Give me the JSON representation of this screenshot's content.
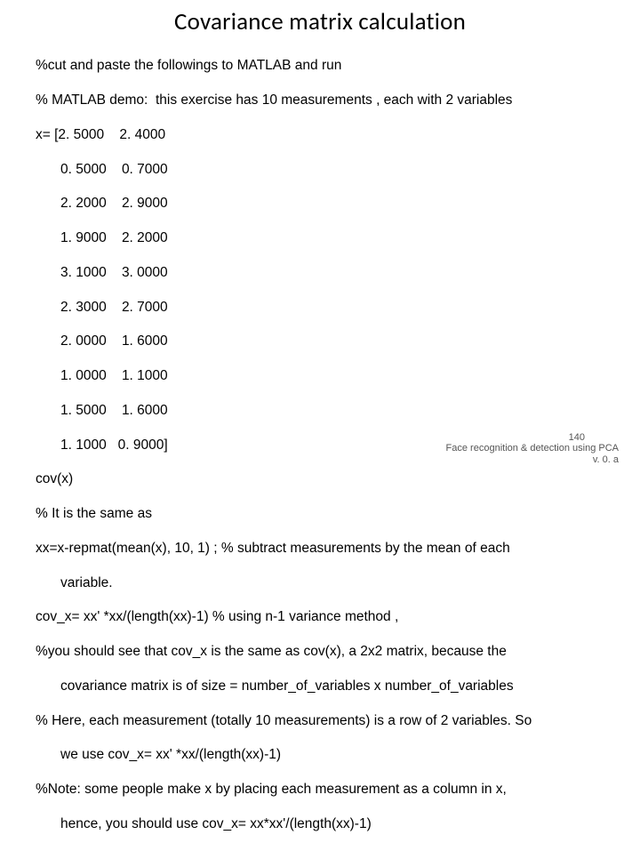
{
  "title": "Covariance matrix calculation",
  "lines": {
    "l0": "%cut and paste the followings to MATLAB and run",
    "l1": "% MATLAB demo:  this exercise has 10 measurements , each with 2 variables",
    "l2": "x= [2. 5000    2. 4000",
    "l3": "0. 5000    0. 7000",
    "l4": "2. 2000    2. 9000",
    "l5": "1. 9000    2. 2000",
    "l6": "3. 1000    3. 0000",
    "l7": "2. 3000    2. 7000",
    "l8": "2. 0000    1. 6000",
    "l9": "1. 0000    1. 1000",
    "l10": "1. 5000    1. 6000",
    "l11": "1. 1000   0. 9000]",
    "l12": "cov(x)",
    "l13": "% It is the same as",
    "l14": "xx=x-repmat(mean(x), 10, 1) ; % subtract measurements by the mean of each",
    "l15": "variable.",
    "l16": "cov_x= xx' *xx/(length(xx)-1) % using n-1 variance method ,",
    "l17": "%you should see that cov_x is the same as cov(x), a 2x2 matrix, because the",
    "l18": "covariance matrix is of size = number_of_variables x number_of_variables",
    "l19": "% Here, each measurement (totally 10 measurements) is a row of 2 variables. So",
    "l20": "we use cov_x= xx' *xx/(length(xx)-1)",
    "l21": "%Note: some people make x by placing each measurement as a column in x,",
    "l22": "hence, you should use cov_x= xx*xx'/(length(xx)-1)"
  },
  "footer": {
    "line1": "Face recognition & detection using PCA",
    "line2": "v. 0. a"
  },
  "page_number": "140"
}
